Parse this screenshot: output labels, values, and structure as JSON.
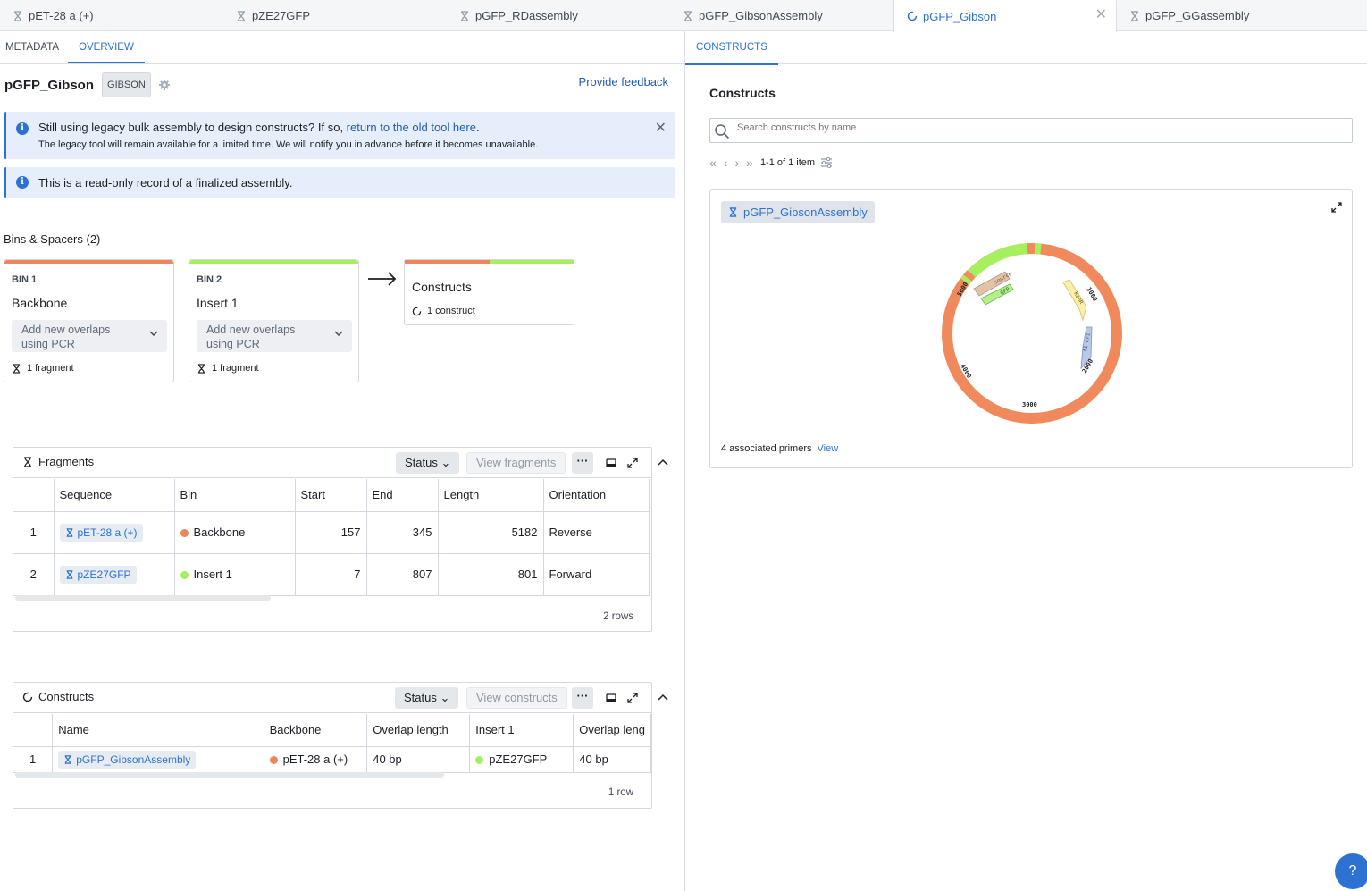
{
  "tabs": [
    {
      "label": "pET-28 a (+)",
      "icon": "hourglass-icon"
    },
    {
      "label": "pZE27GFP",
      "icon": "hourglass-icon"
    },
    {
      "label": "pGFP_RDassembly",
      "icon": "hourglass-icon"
    },
    {
      "label": "pGFP_GibsonAssembly",
      "icon": "hourglass-icon"
    },
    {
      "label": "pGFP_Gibson",
      "icon": "spinner-icon",
      "active": true
    },
    {
      "label": "pGFP_GGassembly",
      "icon": "hourglass-icon"
    }
  ],
  "left": {
    "subtabs": [
      "METADATA",
      "OVERVIEW"
    ],
    "active_subtab": "OVERVIEW",
    "title": "pGFP_Gibson",
    "badge": "GIBSON",
    "feedback": "Provide feedback",
    "legacy_callout": {
      "text": "Still using legacy bulk assembly to design constructs? If so, ",
      "link": "return to the old tool here",
      "after_link": ".",
      "subtext": "The legacy tool will remain available for a limited time. We will notify you in advance before it becomes unavailable."
    },
    "readonly_callout": "This is a read-only record of a finalized assembly.",
    "bins_heading": "Bins & Spacers (2)",
    "bins": [
      {
        "label": "BIN 1",
        "name": "Backbone",
        "select": "Add new overlaps using PCR",
        "fragments": "1 fragment",
        "color": "#f0845c"
      },
      {
        "label": "BIN 2",
        "name": "Insert 1",
        "select": "Add new overlaps using PCR",
        "fragments": "1 fragment",
        "color": "#a6f060"
      }
    ],
    "constructs_bin": {
      "name": "Constructs",
      "count": "1 construct"
    },
    "fragments_panel": {
      "title": "Fragments",
      "status": "Status",
      "view": "View fragments",
      "more": "···",
      "columns": [
        "",
        "Sequence",
        "Bin",
        "Start",
        "End",
        "Length",
        "Orientation"
      ],
      "rows": [
        {
          "idx": "1",
          "sequence": "pET-28 a (+)",
          "bin": "Backbone",
          "bin_color": "#f0845c",
          "start": "157",
          "end": "345",
          "length": "5182",
          "orientation": "Reverse"
        },
        {
          "idx": "2",
          "sequence": "pZE27GFP",
          "bin": "Insert 1",
          "bin_color": "#a6f060",
          "start": "7",
          "end": "807",
          "length": "801",
          "orientation": "Forward"
        }
      ],
      "row_count": "2 rows"
    },
    "constructs_panel": {
      "title": "Constructs",
      "status": "Status",
      "view": "View constructs",
      "more": "···",
      "columns": [
        "",
        "Name",
        "Backbone",
        "Overlap length",
        "Insert 1",
        "Overlap leng"
      ],
      "rows": [
        {
          "idx": "1",
          "name": "pGFP_GibsonAssembly",
          "backbone": "pET-28 a (+)",
          "backbone_color": "#f0845c",
          "overlap": "40 bp",
          "insert": "pZE27GFP",
          "insert_color": "#a6f060",
          "overlap2": "40 bp"
        }
      ],
      "row_count": "1 row"
    }
  },
  "right": {
    "subtab": "CONSTRUCTS",
    "title": "Constructs",
    "search_placeholder": "Search constructs by name",
    "pager": "1-1 of 1 item",
    "card": {
      "chip": "pGFP_GibsonAssembly",
      "primers": "4 associated primers",
      "view": "View",
      "map_labels": [
        "5000",
        "1000",
        "2000",
        "3000",
        "4000"
      ],
      "features": [
        "source",
        "GFP",
        "KanR",
        "f1 ori"
      ]
    },
    "help": "?"
  }
}
